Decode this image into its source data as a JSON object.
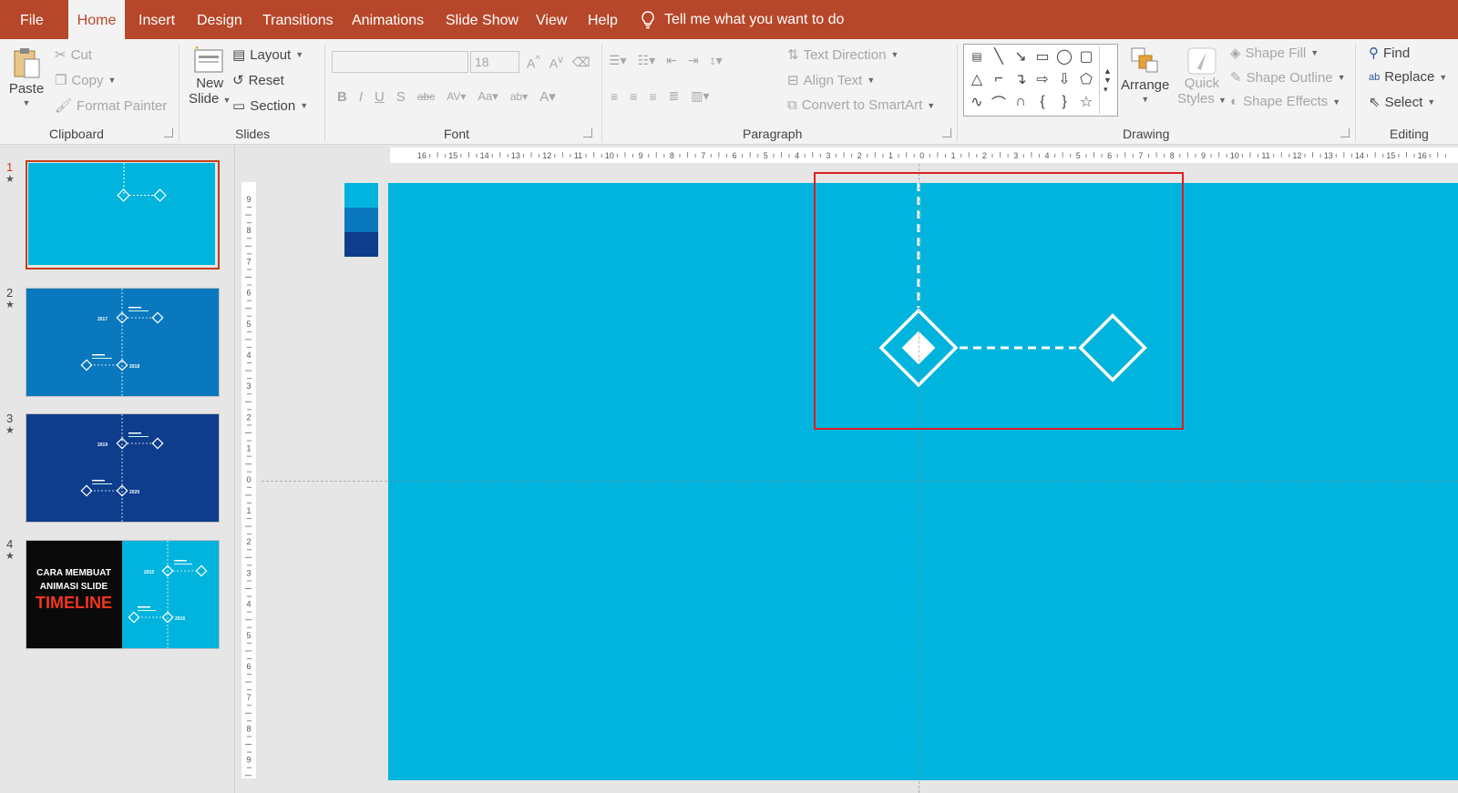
{
  "menu": {
    "tabs": [
      "File",
      "Home",
      "Insert",
      "Design",
      "Transitions",
      "Animations",
      "Slide Show",
      "View",
      "Help"
    ],
    "active_tab": "Home",
    "tell_me": "Tell me what you want to do"
  },
  "ribbon": {
    "clipboard": {
      "paste": "Paste",
      "cut": "Cut",
      "copy": "Copy",
      "format_painter": "Format Painter",
      "group_label": "Clipboard"
    },
    "slides": {
      "new_slide_1": "New",
      "new_slide_2": "Slide",
      "layout": "Layout",
      "reset": "Reset",
      "section": "Section",
      "group_label": "Slides"
    },
    "font": {
      "font_name": "",
      "font_size": "18",
      "group_label": "Font"
    },
    "paragraph": {
      "text_direction": "Text Direction",
      "align_text": "Align Text",
      "convert_smartart": "Convert to SmartArt",
      "group_label": "Paragraph"
    },
    "drawing": {
      "arrange": "Arrange",
      "quick_styles_1": "Quick",
      "quick_styles_2": "Styles",
      "shape_fill": "Shape Fill",
      "shape_outline": "Shape Outline",
      "shape_effects": "Shape Effects",
      "group_label": "Drawing"
    },
    "editing": {
      "find": "Find",
      "replace": "Replace",
      "select": "Select",
      "group_label": "Editing"
    }
  },
  "rulers": {
    "horizontal_ticks": [
      "16",
      "15",
      "14",
      "13",
      "12",
      "11",
      "10",
      "9",
      "8",
      "7",
      "6",
      "5",
      "4",
      "3",
      "2",
      "1",
      "0",
      "1",
      "2",
      "3",
      "4",
      "5",
      "6",
      "7",
      "8",
      "9",
      "10",
      "11",
      "12",
      "13",
      "14",
      "15",
      "16"
    ],
    "vertical_ticks": [
      "9",
      "8",
      "7",
      "6",
      "5",
      "4",
      "3",
      "2",
      "1",
      "0",
      "1",
      "2",
      "3",
      "4",
      "5",
      "6",
      "7",
      "8",
      "9"
    ]
  },
  "thumbnails": {
    "slides": [
      {
        "number": "1",
        "star": "★"
      },
      {
        "number": "2",
        "star": "★",
        "labels": [
          "2017",
          "2018"
        ]
      },
      {
        "number": "3",
        "star": "★",
        "labels": [
          "2019",
          "2020"
        ]
      },
      {
        "number": "4",
        "star": "★",
        "title_1": "CARA MEMBUAT",
        "title_2": "ANIMASI SLIDE",
        "title_3": "TIMELINE",
        "labels": [
          "2015",
          "2016"
        ]
      }
    ],
    "selected": 1
  },
  "colors": {
    "accent": "#b7472a",
    "slide1_bg": "#00b4dd",
    "slide2_bg": "#0a78be",
    "slide3_bg": "#0d3d8c",
    "swatches": [
      "#00b4dd",
      "#0a78be",
      "#0d3d8c"
    ],
    "selection_box": "#e01e1e"
  }
}
